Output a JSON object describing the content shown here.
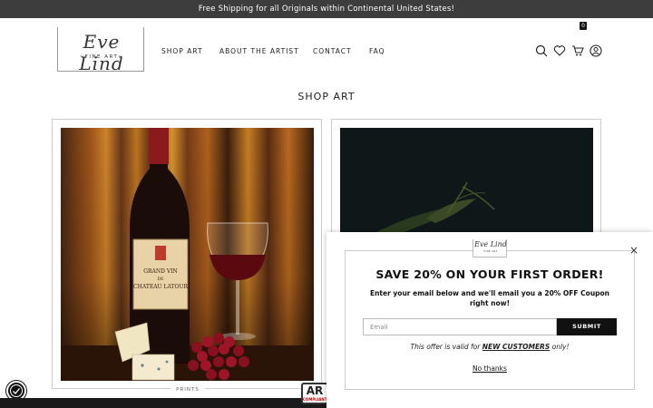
{
  "announcement": "Free Shipping for all Originals within Continental United States!",
  "brand": {
    "script": "Eve Lind",
    "sub": "~FINE ART~"
  },
  "nav": [
    {
      "label": "SHOP ART"
    },
    {
      "label": "ABOUT THE ARTIST"
    },
    {
      "label": "CONTACT"
    },
    {
      "label": "FAQ"
    }
  ],
  "header_icons": [
    "search-icon",
    "heart-icon",
    "cart-icon",
    "account-icon"
  ],
  "cart_count": "0",
  "page_title": "SHOP ART",
  "products": [
    {
      "label": "PRINTS",
      "art_text": "GRAND VIN DE CHATEAU LATOUR"
    },
    {
      "label": ""
    }
  ],
  "popup": {
    "logo_script": "Eve Lind",
    "logo_sub": "FINE ART",
    "close": "×",
    "title": "SAVE 20% ON YOUR FIRST ORDER!",
    "description": "Enter your email below and we'll email you a 20% OFF Coupon right now!",
    "email_placeholder": "Email",
    "submit_label": "SUBMIT",
    "offer_prefix": "This offer is valid for ",
    "offer_highlight": "NEW CUSTOMERS",
    "offer_suffix": " only!",
    "decline_label": "No thanks"
  },
  "ar_badge": {
    "main": "AR",
    "small": "COMPLIANT"
  },
  "colors": {
    "announcement_bg": "#3d3d3d",
    "button_bg": "#111111",
    "accent": "#111111"
  }
}
